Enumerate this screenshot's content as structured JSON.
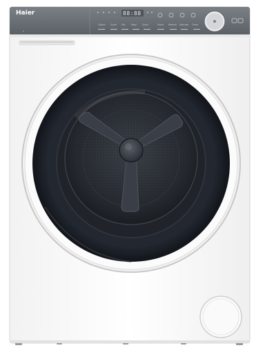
{
  "product": {
    "brand": "Haier",
    "type": "front-loading heat pump tumble dryer",
    "body_color": "#f7f7f7",
    "panel_color": "#6c7078",
    "door_frame_color": "#1b1f26",
    "drum_color": "#2a2e34"
  },
  "control_panel": {
    "display_digits": "88:88",
    "program_labels": [
      "Cotton",
      "Synth",
      "Mix",
      "Wool",
      "Quick",
      "Shirts",
      "Refresh",
      "Delicate",
      "Timer"
    ],
    "icons": [
      "power-knob",
      "program-dial",
      "indicator-lights"
    ]
  }
}
